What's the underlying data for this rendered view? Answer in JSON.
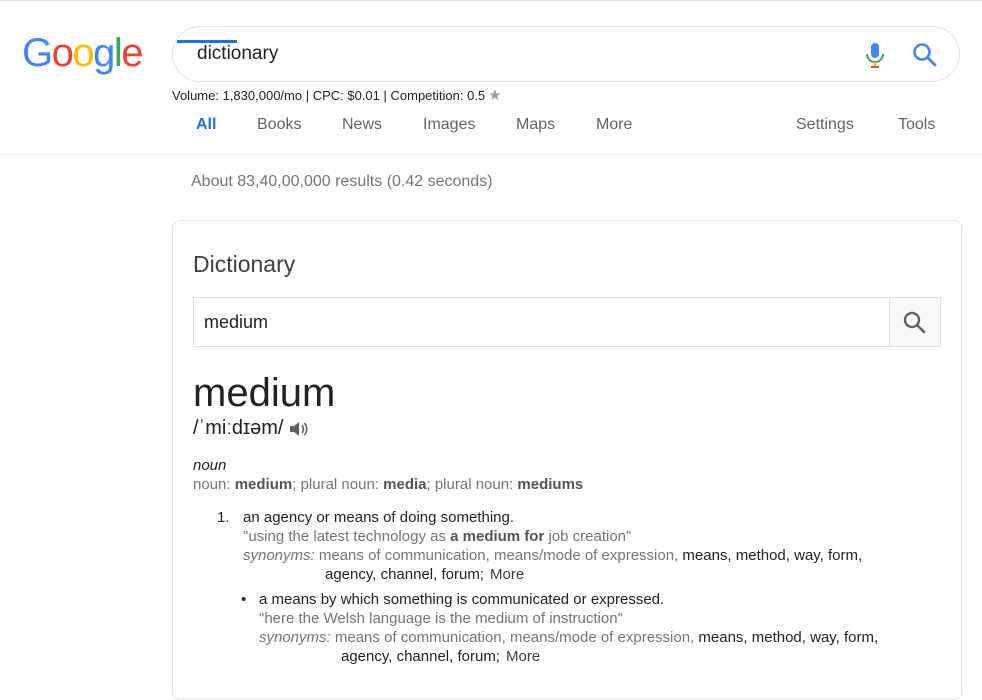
{
  "logo": {
    "letters": [
      "G",
      "o",
      "o",
      "g",
      "l",
      "e"
    ],
    "colors": [
      "#4285f4",
      "#ea4335",
      "#fbbc05",
      "#4285f4",
      "#34a853",
      "#ea4335"
    ]
  },
  "search": {
    "query": "dictionary",
    "mic_icon": "mic-icon",
    "search_icon": "search-icon"
  },
  "keyword_info": {
    "text": "Volume: 1,830,000/mo | CPC: $0.01 | Competition: 0.5",
    "star_icon": "star-icon"
  },
  "tabs": [
    {
      "label": "All",
      "active": true
    },
    {
      "label": "Books"
    },
    {
      "label": "News"
    },
    {
      "label": "Images"
    },
    {
      "label": "Maps"
    },
    {
      "label": "More"
    },
    {
      "label": "Settings"
    },
    {
      "label": "Tools"
    }
  ],
  "stats": "About 83,40,00,000 results (0.42 seconds)",
  "dictionary": {
    "title": "Dictionary",
    "input_value": "medium",
    "headword": "medium",
    "phonetic": "/ˈmiːdɪəm/",
    "part_of_speech": "noun",
    "forms": {
      "label1": "noun: ",
      "w1": "medium",
      "sep1": "; plural noun: ",
      "w2": "media",
      "sep2": "; plural noun: ",
      "w3": "mediums"
    },
    "def1": {
      "number": "1.",
      "text": "an agency or means of doing something.",
      "example_pre": "\"using the latest technology as ",
      "example_bold": "a medium for",
      "example_post": " job creation\"",
      "syn_label": "synonyms:",
      "syn_line1_grey": "means of communication, means/mode of expression,",
      "syn_line1_dark": "means, method, way, form,",
      "syn_line2_dark": "agency, channel, forum;",
      "more": "More"
    },
    "def1b": {
      "bullet": "•",
      "text": "a means by which something is communicated or expressed.",
      "example": "\"here the Welsh language is the medium of instruction\"",
      "syn_label": "synonyms:",
      "syn_line1_grey": "means of communication, means/mode of expression,",
      "syn_line1_dark": "means, method, way, form,",
      "syn_line2_dark": "agency, channel, forum;",
      "more": "More"
    }
  },
  "colors": {
    "accent": "#1a73e8",
    "grey_text": "#70757a"
  }
}
